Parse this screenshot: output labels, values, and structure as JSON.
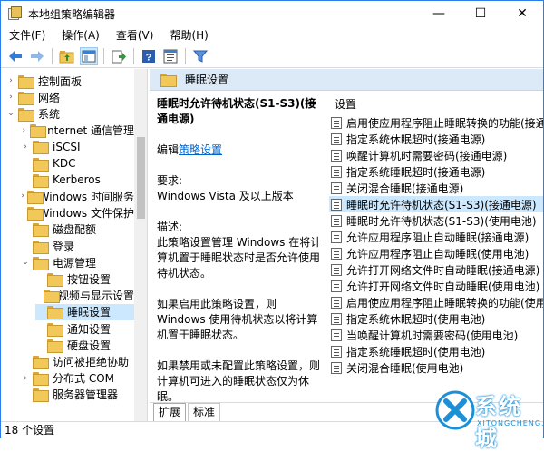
{
  "window": {
    "title": "本地组策略编辑器",
    "minimize": "—",
    "maximize": "☐",
    "close": "✕"
  },
  "menu": [
    "文件(F)",
    "操作(A)",
    "查看(V)",
    "帮助(H)"
  ],
  "toolbar_icons": [
    "back-icon",
    "forward-icon",
    "folder-up-icon",
    "show-tree-icon",
    "export-icon",
    "help-icon",
    "properties-icon",
    "filter-icon"
  ],
  "tree": [
    {
      "label": "控制面板",
      "level": 0,
      "arrow": "›"
    },
    {
      "label": "网络",
      "level": 0,
      "arrow": "›"
    },
    {
      "label": "系统",
      "level": 0,
      "arrow": "⌄"
    },
    {
      "label": "Internet 通信管理",
      "level": 1,
      "arrow": "›"
    },
    {
      "label": "iSCSI",
      "level": 1,
      "arrow": "›"
    },
    {
      "label": "KDC",
      "level": 1,
      "arrow": ""
    },
    {
      "label": "Kerberos",
      "level": 1,
      "arrow": ""
    },
    {
      "label": "Windows 时间服务",
      "level": 1,
      "arrow": "›"
    },
    {
      "label": "Windows 文件保护",
      "level": 1,
      "arrow": ""
    },
    {
      "label": "磁盘配额",
      "level": 1,
      "arrow": ""
    },
    {
      "label": "登录",
      "level": 1,
      "arrow": ""
    },
    {
      "label": "电源管理",
      "level": 1,
      "arrow": "⌄"
    },
    {
      "label": "按钮设置",
      "level": 2,
      "arrow": ""
    },
    {
      "label": "视频与显示设置",
      "level": 2,
      "arrow": ""
    },
    {
      "label": "睡眠设置",
      "level": 2,
      "arrow": "",
      "selected": true
    },
    {
      "label": "通知设置",
      "level": 2,
      "arrow": ""
    },
    {
      "label": "硬盘设置",
      "level": 2,
      "arrow": ""
    },
    {
      "label": "访问被拒绝协助",
      "level": 1,
      "arrow": ""
    },
    {
      "label": "分布式 COM",
      "level": 1,
      "arrow": "›"
    },
    {
      "label": "服务器管理器",
      "level": 1,
      "arrow": ""
    }
  ],
  "right_header": "睡眠设置",
  "description": {
    "title": "睡眠时允许待机状态(S1-S3)(接通电源)",
    "edit_prefix": "编辑",
    "edit_link": "策略设置",
    "requirements_label": "要求:",
    "requirements_value": "Windows Vista 及以上版本",
    "desc_label": "描述:",
    "desc_text": "此策略设置管理 Windows 在将计算机置于睡眠状态时是否允许使用待机状态。",
    "enabled_text": "如果启用此策略设置，则 Windows 使用待机状态以将计算机置于睡眠状态。",
    "disabled_text": "如果禁用或未配置此策略设置，则计算机可进入的睡眠状态仅为休眠。"
  },
  "list_header": "设置",
  "settings": [
    "启用使应用程序阻止睡眠转换的功能(接通",
    "指定系统休眠超时(接通电源)",
    "唤醒计算机时需要密码(接通电源)",
    "指定系统睡眠超时(接通电源)",
    "关闭混合睡眠(接通电源)",
    "睡眠时允许待机状态(S1-S3)(接通电源)",
    "睡眠时允许待机状态(S1-S3)(使用电池)",
    "允许应用程序阻止自动睡眠(接通电源)",
    "允许应用程序阻止自动睡眠(使用电池)",
    "允许打开网络文件时自动睡眠(接通电源)",
    "允许打开网络文件时自动睡眠(使用电池)",
    "启用使应用程序阻止睡眠转换的功能(使用",
    "指定系统休眠超时(使用电池)",
    "当唤醒计算机时需要密码(使用电池)",
    "指定系统睡眠超时(使用电池)",
    "关闭混合睡眠(使用电池)"
  ],
  "selected_setting": 5,
  "tabs": [
    "扩展",
    "标准"
  ],
  "status": "18 个设置",
  "watermark": {
    "brand": "系统城",
    "url": "XITONGCHENG.COM"
  },
  "colors": {
    "selection": "#cce8ff",
    "header": "#dce9f6",
    "link": "#0066cc",
    "border": "#2b7de9"
  }
}
